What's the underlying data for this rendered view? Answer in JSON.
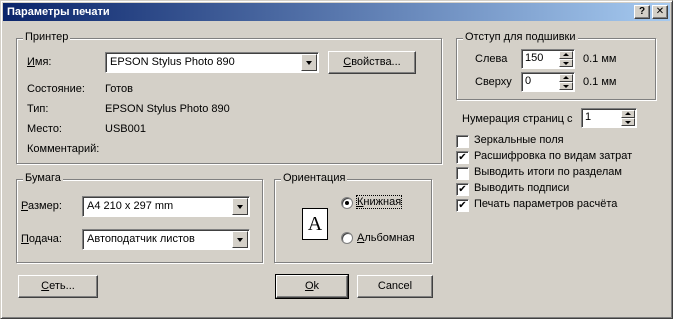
{
  "window": {
    "title": "Параметры печати",
    "help_button": "?",
    "close_button": "✕"
  },
  "printer": {
    "group_title": "Принтер",
    "name_label_first": "И",
    "name_label_rest": "мя:",
    "name_value": "EPSON Stylus Photo 890",
    "properties_button_first": "С",
    "properties_button_rest": "войства...",
    "status_label": "Состояние:",
    "status_value": "Готов",
    "type_label": "Тип:",
    "type_value": "EPSON Stylus Photo 890",
    "where_label": "Место:",
    "where_value": "USB001",
    "comment_label": "Комментарий:"
  },
  "binding_offset": {
    "group_title": "Отступ для подшивки",
    "left_label": "Слева",
    "left_value": "150",
    "left_unit": "0.1 мм",
    "top_label": "Сверху",
    "top_value": "0",
    "top_unit": "0.1 мм"
  },
  "page_numbering": {
    "label": "Нумерация страниц с",
    "value": "1"
  },
  "options": [
    {
      "label": "Зеркальные поля",
      "checked": false
    },
    {
      "label": "Расшифровка по видам затрат",
      "checked": true
    },
    {
      "label": "Выводить итоги по разделам",
      "checked": false
    },
    {
      "label": "Выводить подписи",
      "checked": true
    },
    {
      "label": "Печать параметров расчёта",
      "checked": true
    }
  ],
  "paper": {
    "group_title": "Бумага",
    "size_label_first": "Р",
    "size_label_rest": "азмер:",
    "size_value": "A4 210 x 297 mm",
    "source_label_first": "П",
    "source_label_rest": "одача:",
    "source_value": "Автоподатчик листов"
  },
  "orientation": {
    "group_title": "Ориентация",
    "portrait_label_first": "К",
    "portrait_label_rest": "нижная",
    "landscape_label_first": "А",
    "landscape_label_rest": "льбомная",
    "icon_letter": "A",
    "selected": "portrait"
  },
  "buttons": {
    "network_first": "С",
    "network_rest": "еть...",
    "ok_first": "O",
    "ok_rest": "k",
    "cancel": "Cancel"
  }
}
